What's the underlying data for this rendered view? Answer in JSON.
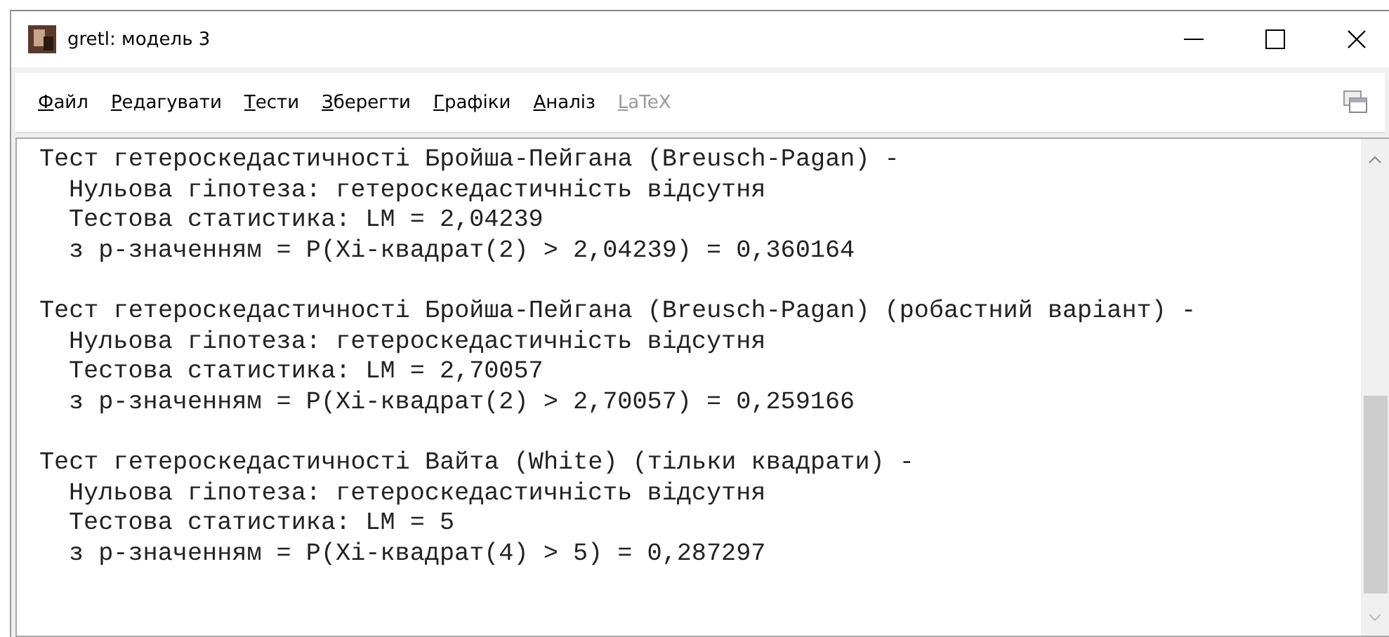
{
  "window": {
    "title": "gretl: модель 3"
  },
  "menu": [
    {
      "label": "Файл",
      "disabled": false
    },
    {
      "label": "Редагувати",
      "disabled": false
    },
    {
      "label": "Тести",
      "disabled": false
    },
    {
      "label": "Зберегти",
      "disabled": false
    },
    {
      "label": "Графіки",
      "disabled": false
    },
    {
      "label": "Аналіз",
      "disabled": false
    },
    {
      "label": "LaTeX",
      "disabled": true
    }
  ],
  "output": [
    {
      "heading": "Тест гетероскедастичності Бройша-Пейгана (Breusch-Pagan) -",
      "lines": [
        "Нульова гіпотеза: гетероскедастичність відсутня",
        "Тестова статистика: LM = 2,04239",
        "з p-значенням = P(Xi-квадрат(2) > 2,04239) = 0,360164"
      ]
    },
    {
      "heading": "Тест гетероскедастичності Бройша-Пейгана (Breusch-Pagan) (робастний варіант) -",
      "lines": [
        "Нульова гіпотеза: гетероскедастичність відсутня",
        "Тестова статистика: LM = 2,70057",
        "з p-значенням = P(Xi-квадрат(2) > 2,70057) = 0,259166"
      ]
    },
    {
      "heading": "Тест гетероскедастичності Вайта (White) (тільки квадрати) -",
      "lines": [
        "Нульова гіпотеза: гетероскедастичність відсутня",
        "Тестова статистика: LM = 5",
        "з p-значенням = P(Xi-квадрат(4) > 5) = 0,287297"
      ]
    }
  ]
}
